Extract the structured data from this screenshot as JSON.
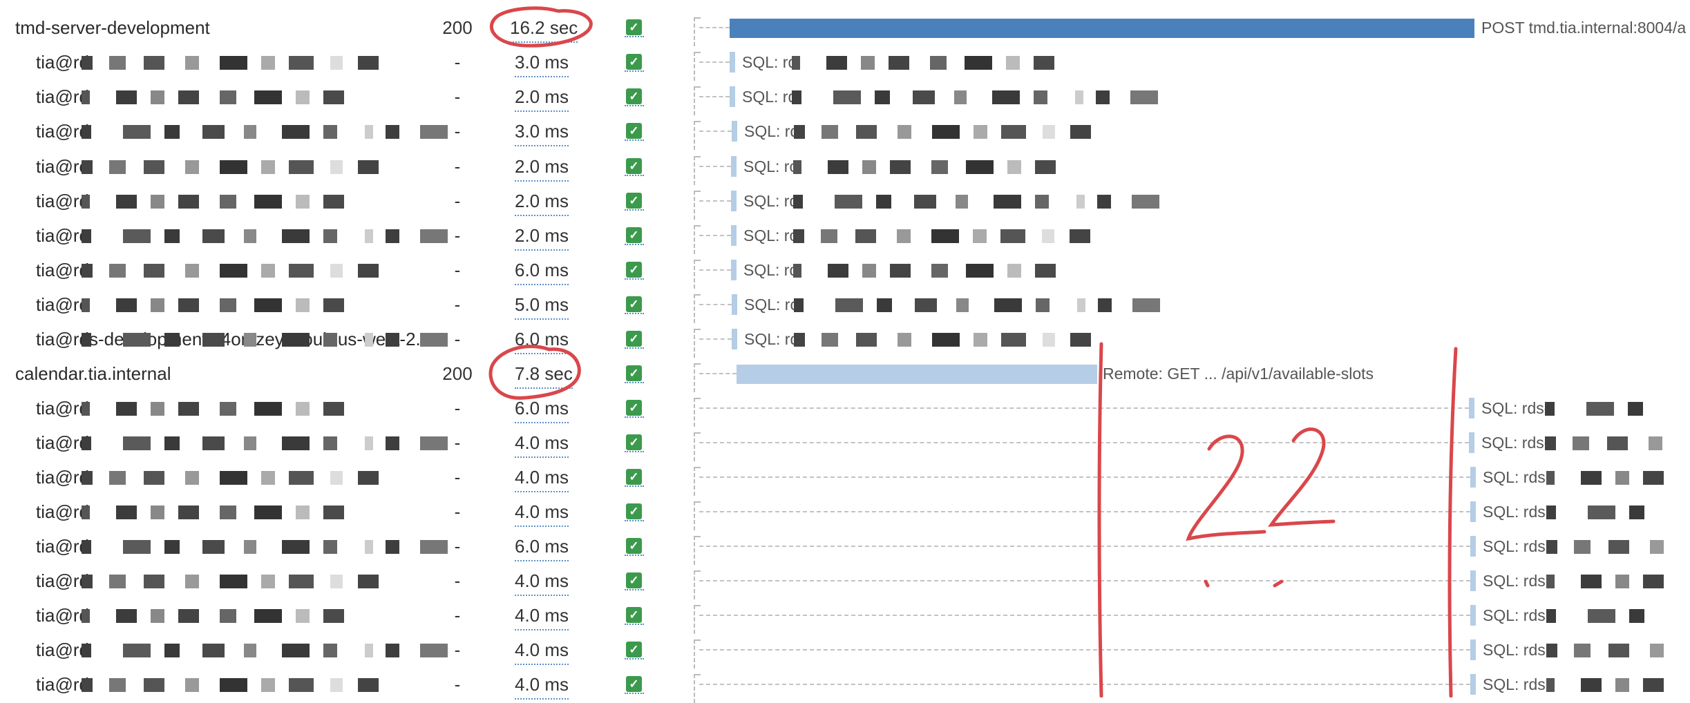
{
  "colors": {
    "span_bar": "#4a81bd",
    "child_bar": "#b5cde6",
    "check": "#3c9a4c",
    "annotation": "#d9474b"
  },
  "rows": [
    {
      "name": "tmd-server-development",
      "status": "200",
      "duration": "16.2 sec",
      "label": "POST tmd.tia.internal:8004/a",
      "level": 0
    },
    {
      "name": "tia@rd",
      "status": "-",
      "duration": "3.0 ms",
      "label": "SQL: rd",
      "level": 1
    },
    {
      "name": "tia@rd",
      "status": "-",
      "duration": "2.0 ms",
      "label": "SQL: rd",
      "level": 1
    },
    {
      "name": "tia@rd",
      "status": "-",
      "duration": "3.0 ms",
      "label": "SQL: rd",
      "level": 1
    },
    {
      "name": "tia@rc",
      "status": "-",
      "duration": "2.0 ms",
      "label": "SQL: rc",
      "level": 1
    },
    {
      "name": "tia@rd",
      "status": "-",
      "duration": "2.0 ms",
      "label": "SQL: rd",
      "level": 1
    },
    {
      "name": "tia@rc",
      "status": "-",
      "duration": "2.0 ms",
      "label": "SQL: rc",
      "level": 1
    },
    {
      "name": "tia@rd",
      "status": "-",
      "duration": "6.0 ms",
      "label": "SQL: rd",
      "level": 1
    },
    {
      "name": "tia@rc",
      "status": "-",
      "duration": "5.0 ms",
      "label": "SQL: rc",
      "level": 1
    },
    {
      "name": "tia@rds-development.c4omzeyvaoub.us-west-2.",
      "status": "-",
      "duration": "6.0 ms",
      "label": "SQL: rd",
      "level": 1
    },
    {
      "name": "calendar.tia.internal",
      "status": "200",
      "duration": "7.8 sec",
      "label": "Remote: GET ... /api/v1/available-slots",
      "level": 0
    },
    {
      "name": "tia@rd",
      "status": "-",
      "duration": "6.0 ms",
      "label": "SQL: rds-",
      "level": 1
    },
    {
      "name": "tia@rd",
      "status": "-",
      "duration": "4.0 ms",
      "label": "SQL: rds-",
      "level": 1
    },
    {
      "name": "tia@rd",
      "status": "-",
      "duration": "4.0 ms",
      "label": "SQL: rds",
      "level": 1
    },
    {
      "name": "tia@rd",
      "status": "-",
      "duration": "4.0 ms",
      "label": "SQL: rds",
      "level": 1
    },
    {
      "name": "tia@rd",
      "status": "-",
      "duration": "6.0 ms",
      "label": "SQL: rds",
      "level": 1
    },
    {
      "name": "tia@rd",
      "status": "-",
      "duration": "4.0 ms",
      "label": "SQL: rds",
      "level": 1
    },
    {
      "name": "tia@rd",
      "status": "-",
      "duration": "4.0 ms",
      "label": "SQL: rds",
      "level": 1
    },
    {
      "name": "tia@rd",
      "status": "-",
      "duration": "4.0 ms",
      "label": "SQL: rds",
      "level": 1
    },
    {
      "name": "tia@rd",
      "status": "-",
      "duration": "4.0 ms",
      "label": "SQL: rds",
      "level": 1
    }
  ],
  "annotation": {
    "text": "22"
  }
}
